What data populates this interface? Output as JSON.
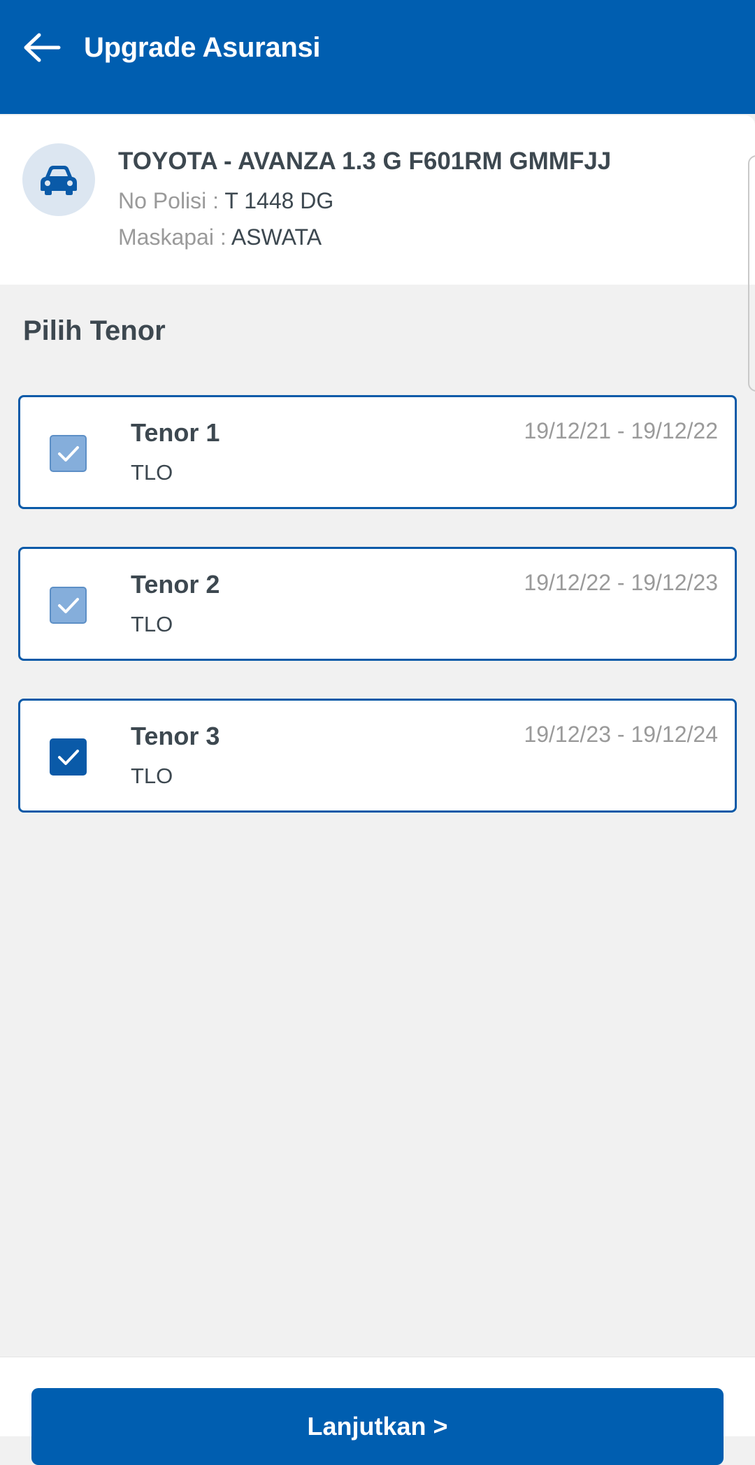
{
  "header": {
    "back_icon": "arrow-left-icon",
    "title": "Upgrade Asuransi"
  },
  "vehicle": {
    "icon": "car-icon",
    "name": "TOYOTA - AVANZA 1.3 G F601RM GMMFJJ",
    "police_label": "No Polisi :",
    "police_value": "T 1448 DG",
    "insurer_label": "Maskapai :",
    "insurer_value": "ASWATA"
  },
  "section": {
    "title": "Pilih Tenor"
  },
  "tenors": [
    {
      "name": "Tenor 1",
      "type": "TLO",
      "dates": "19/12/21 - 19/12/22",
      "checked": true,
      "locked": true
    },
    {
      "name": "Tenor 2",
      "type": "TLO",
      "dates": "19/12/22 - 19/12/23",
      "checked": true,
      "locked": true
    },
    {
      "name": "Tenor 3",
      "type": "TLO",
      "dates": "19/12/23 - 19/12/24",
      "checked": true,
      "locked": false
    }
  ],
  "footer": {
    "continue_label": "Lanjutkan >"
  },
  "colors": {
    "primary": "#005eb0",
    "checkbox_locked": "#85aedb",
    "text": "#3d4850",
    "muted": "#9a9a9a",
    "background": "#f1f1f1"
  }
}
